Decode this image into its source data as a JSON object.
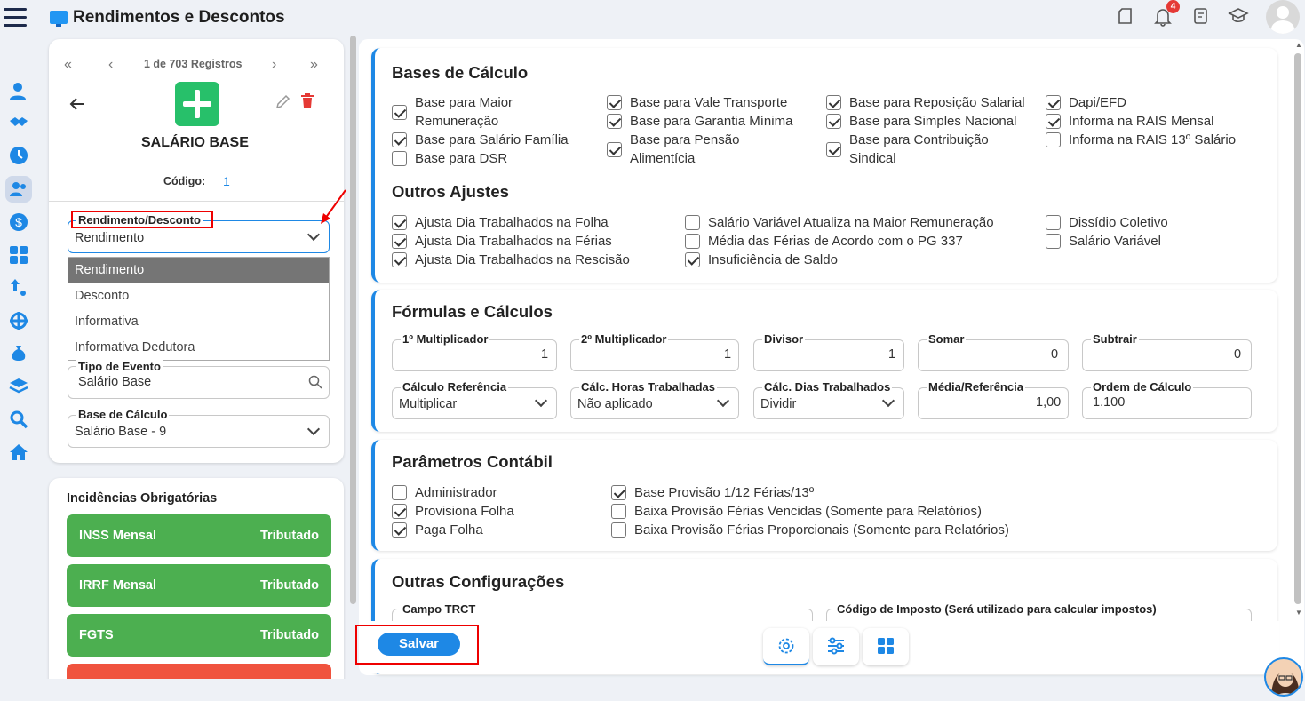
{
  "app": {
    "title": "Rendimentos e Descontos",
    "notifications": "4"
  },
  "record": {
    "pager_text": "1 de 703 Registros",
    "name": "SALÁRIO BASE",
    "code_label": "Código:",
    "code_value": "1"
  },
  "form": {
    "tipo_label": "Rendimento/Desconto",
    "tipo_value": "Rendimento",
    "tipo_options": [
      "Rendimento",
      "Desconto",
      "Informativa",
      "Informativa Dedutora"
    ],
    "evento_label": "Tipo de Evento",
    "evento_value": "Salário Base",
    "base_label": "Base de Cálculo",
    "base_value": "Salário Base - 9"
  },
  "incidencias": {
    "title": "Incidências Obrigatórias",
    "items": [
      {
        "name": "INSS Mensal",
        "status": "Tributado"
      },
      {
        "name": "IRRF Mensal",
        "status": "Tributado"
      },
      {
        "name": "FGTS",
        "status": "Tributado"
      }
    ]
  },
  "bases": {
    "title": "Bases de Cálculo",
    "items": [
      {
        "label": "Base para Maior Remuneração",
        "checked": true
      },
      {
        "label": "Base para Salário Família",
        "checked": true
      },
      {
        "label": "Base para DSR",
        "checked": false
      },
      {
        "label": "Base para Vale Transporte",
        "checked": true
      },
      {
        "label": "Base para Garantia Mínima",
        "checked": true
      },
      {
        "label": "Base para Pensão Alimentícia",
        "checked": true
      },
      {
        "label": "Base para Reposição Salarial",
        "checked": true
      },
      {
        "label": "Base para Simples Nacional",
        "checked": true
      },
      {
        "label": "Base para Contribuição Sindical",
        "checked": true
      },
      {
        "label": "Dapi/EFD",
        "checked": true
      },
      {
        "label": "Informa na RAIS Mensal",
        "checked": true
      },
      {
        "label": "Informa na RAIS 13º Salário",
        "checked": false
      }
    ]
  },
  "ajustes": {
    "title": "Outros Ajustes",
    "items": [
      {
        "label": "Ajusta Dia Trabalhados na Folha",
        "checked": true
      },
      {
        "label": "Ajusta Dia Trabalhados na Férias",
        "checked": true
      },
      {
        "label": "Ajusta Dia Trabalhados na Rescisão",
        "checked": true
      },
      {
        "label": "Salário Variável Atualiza na Maior Remuneração",
        "checked": false
      },
      {
        "label": "Média das Férias de Acordo com o PG 337",
        "checked": false
      },
      {
        "label": "Insuficiência de Saldo",
        "checked": true
      },
      {
        "label": "Dissídio Coletivo",
        "checked": false
      },
      {
        "label": "Salário Variável",
        "checked": false
      }
    ]
  },
  "formulas": {
    "title": "Fórmulas e Cálculos",
    "fields": [
      {
        "label": "1º Multiplicador",
        "value": "1"
      },
      {
        "label": "2º Multiplicador",
        "value": "1"
      },
      {
        "label": "Divisor",
        "value": "1"
      },
      {
        "label": "Somar",
        "value": "0"
      },
      {
        "label": "Subtrair",
        "value": "0"
      },
      {
        "label": "Cálculo Referência",
        "value": "Multiplicar"
      },
      {
        "label": "Cálc. Horas Trabalhadas",
        "value": "Não aplicado"
      },
      {
        "label": "Cálc. Dias Trabalhados",
        "value": "Dividir"
      },
      {
        "label": "Média/Referência",
        "value": "1,00"
      },
      {
        "label": "Ordem de Cálculo",
        "value": "1.100"
      }
    ]
  },
  "contabil": {
    "title": "Parâmetros Contábil",
    "items": [
      {
        "label": "Administrador",
        "checked": false
      },
      {
        "label": "Provisiona Folha",
        "checked": true
      },
      {
        "label": "Paga Folha",
        "checked": true
      },
      {
        "label": "Base Provisão 1/12 Férias/13º",
        "checked": true
      },
      {
        "label": "Baixa Provisão Férias Vencidas (Somente para Relatórios)",
        "checked": false
      },
      {
        "label": "Baixa Provisão Férias Proporcionais (Somente para Relatórios)",
        "checked": false
      }
    ]
  },
  "outras": {
    "title": "Outras Configurações",
    "trct_label": "Campo TRCT",
    "imposto_label": "Código de Imposto (Será utilizado para calcular impostos)"
  },
  "actions": {
    "save": "Salvar"
  }
}
